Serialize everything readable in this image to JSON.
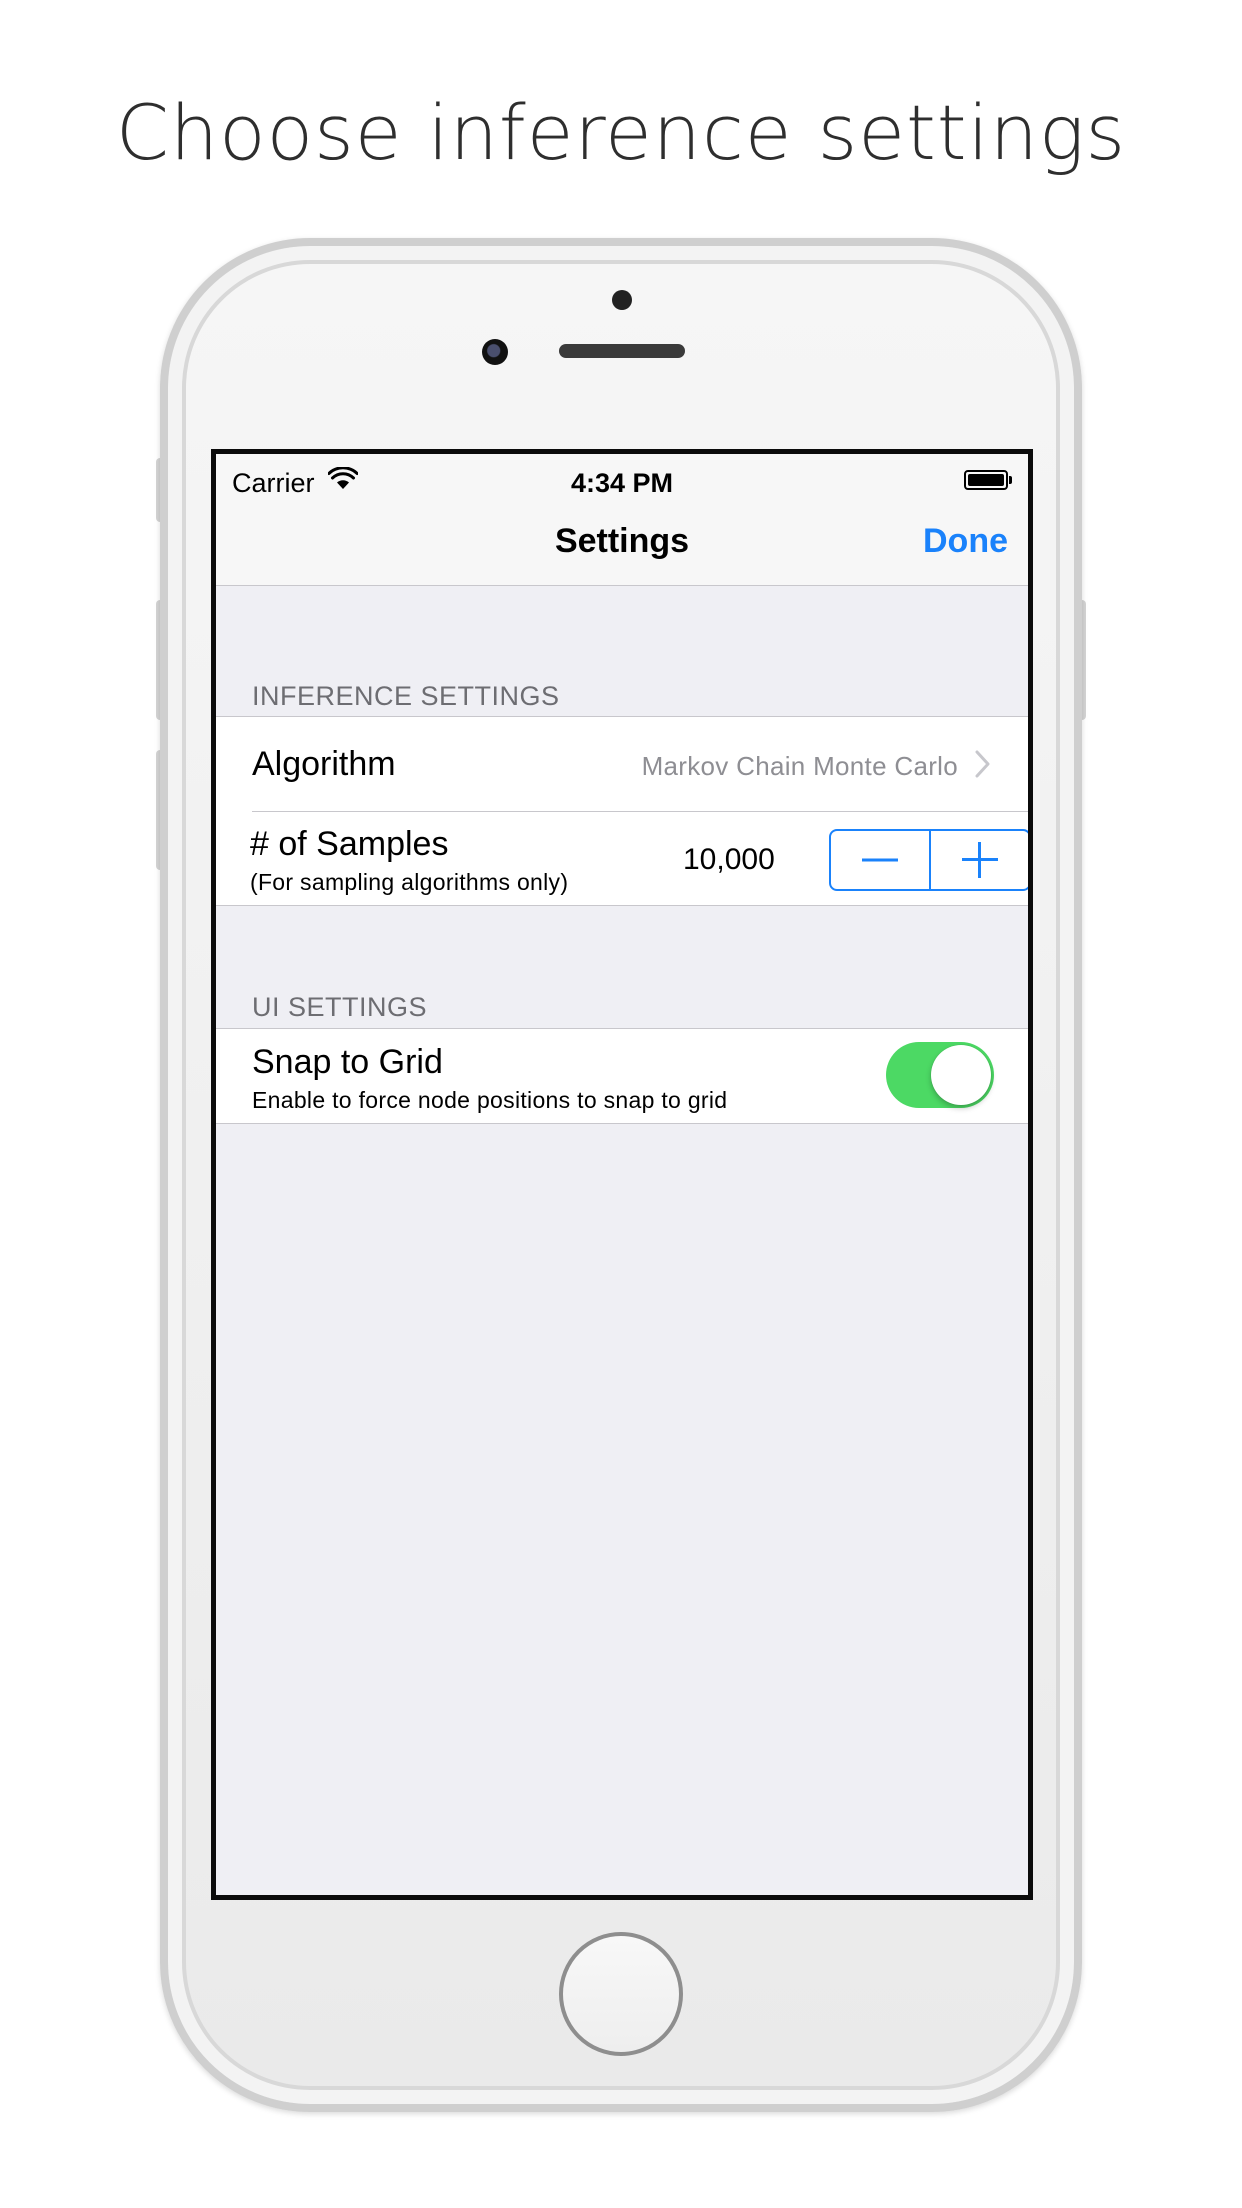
{
  "headline": "Choose inference settings",
  "status_bar": {
    "carrier": "Carrier",
    "time": "4:34 PM",
    "icons": [
      "wifi-icon",
      "battery-icon"
    ]
  },
  "navbar": {
    "title": "Settings",
    "done_label": "Done"
  },
  "sections": {
    "inference": {
      "header": "INFERENCE SETTINGS",
      "algorithm": {
        "label": "Algorithm",
        "value": "Markov Chain Monte Carlo",
        "icon": "chevron-right-icon"
      },
      "samples": {
        "label": "# of Samples",
        "sublabel": "(For sampling algorithms only)",
        "value": "10,000",
        "icons": [
          "minus-icon",
          "plus-icon"
        ]
      }
    },
    "ui": {
      "header": "UI SETTINGS",
      "snap": {
        "label": "Snap to Grid",
        "sublabel": "Enable to force node positions to snap to grid",
        "enabled": true
      }
    }
  },
  "colors": {
    "accent": "#1a82fb",
    "toggle_on": "#4cd964",
    "background": "#efeff4",
    "secondary_text": "#8e8e93"
  }
}
